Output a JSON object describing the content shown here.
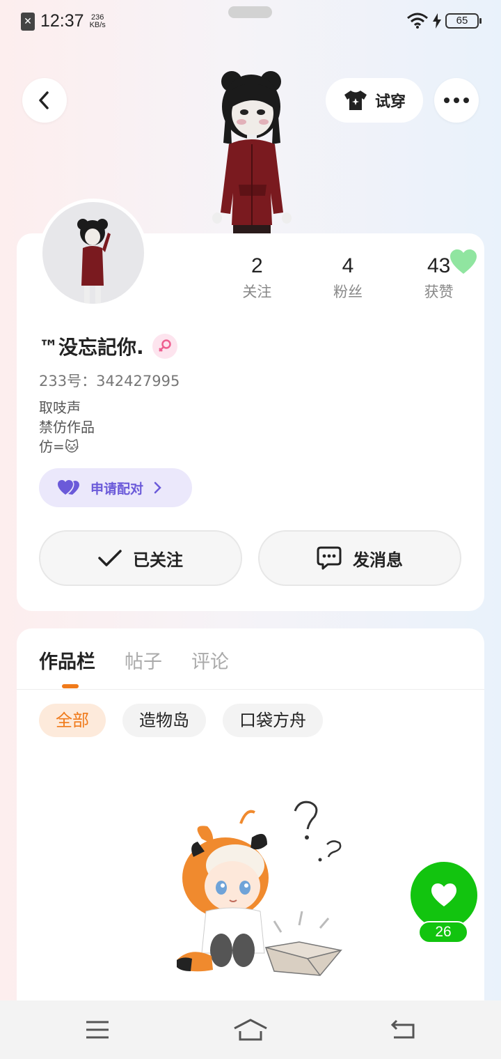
{
  "status_bar": {
    "time": "12:37",
    "net_speed_value": "236",
    "net_speed_unit": "KB/s",
    "battery": "65"
  },
  "header": {
    "tryon_label": "试穿"
  },
  "profile": {
    "stats": [
      {
        "value": "2",
        "label": "关注"
      },
      {
        "value": "4",
        "label": "粉丝"
      },
      {
        "value": "43",
        "label": "获赞"
      }
    ],
    "username": "™没忘記你.",
    "uid": "233号：342427995",
    "bio_lines": [
      "取吱声",
      "禁仿作品",
      "仿=🐱"
    ],
    "pair_label": "申请配对",
    "follow_label": "已关注",
    "message_label": "发消息"
  },
  "content": {
    "tabs": [
      "作品栏",
      "帖子",
      "评论"
    ],
    "chips": [
      "全部",
      "造物岛",
      "口袋方舟"
    ]
  },
  "like": {
    "count": "26"
  },
  "colors": {
    "accent_orange": "#f07a1a",
    "like_green": "#12c40f",
    "pair_purple": "#6b5ad9"
  }
}
